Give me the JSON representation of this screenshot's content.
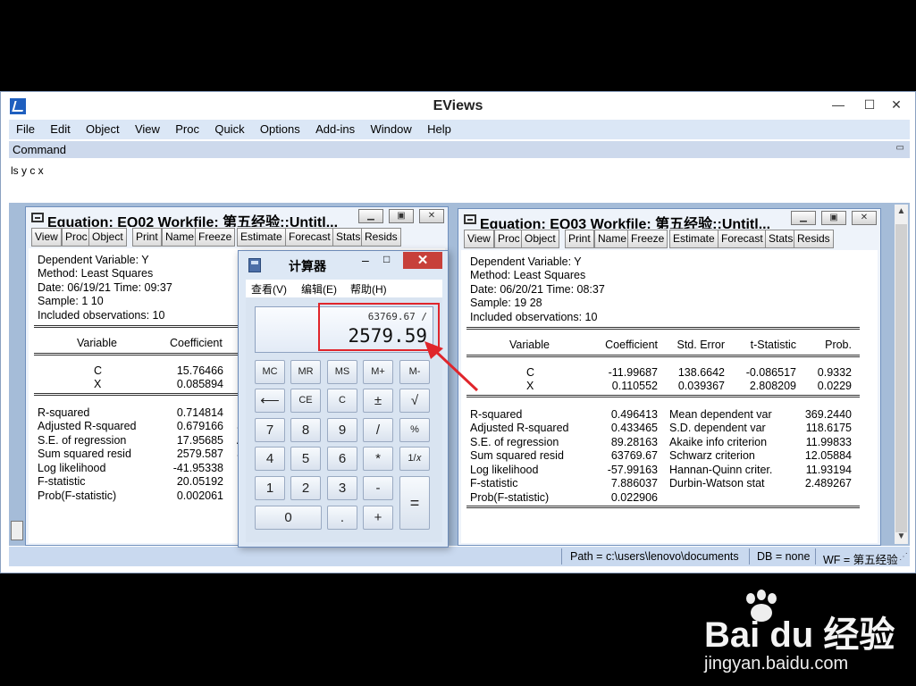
{
  "app": {
    "title": "EViews",
    "min": "—",
    "max": "☐",
    "close": "✕",
    "menu": [
      "File",
      "Edit",
      "Object",
      "View",
      "Proc",
      "Quick",
      "Options",
      "Add-ins",
      "Window",
      "Help"
    ],
    "command_header": "Command",
    "command_text": "ls y c x"
  },
  "toolbar_buttons": [
    "View",
    "Proc",
    "Object",
    "Print",
    "Name",
    "Freeze",
    "Estimate",
    "Forecast",
    "Stats",
    "Resids"
  ],
  "eq1": {
    "title": "Equation: EQ02   Workfile: 第五经验::Untitl...",
    "header": [
      "Dependent Variable: Y",
      "Method: Least Squares",
      "Date: 06/19/21   Time: 09:37",
      "Sample: 1 10",
      "Included observations: 10"
    ],
    "col_variable": "Variable",
    "col_coefficient": "Coefficient",
    "rows": [
      {
        "var": "C",
        "coef": "15.76466"
      },
      {
        "var": "X",
        "coef": "0.085894"
      }
    ],
    "stats": [
      {
        "label": "R-squared",
        "value": "0.714814",
        "extra": "M"
      },
      {
        "label": "Adjusted R-squared",
        "value": "0.679166",
        "extra": "S"
      },
      {
        "label": "S.E. of regression",
        "value": "17.95685",
        "extra": "A"
      },
      {
        "label": "Sum squared resid",
        "value": "2579.587",
        "extra": "S"
      },
      {
        "label": "Log likelihood",
        "value": "-41.95338",
        "extra": "H"
      },
      {
        "label": "F-statistic",
        "value": "20.05192",
        "extra": "D"
      },
      {
        "label": "Prob(F-statistic)",
        "value": "0.002061",
        "extra": ""
      }
    ]
  },
  "eq2": {
    "title": "Equation: EQ03   Workfile: 第五经验::Untitl...",
    "header": [
      "Dependent Variable: Y",
      "Method: Least Squares",
      "Date: 06/20/21   Time: 08:37",
      "Sample: 19 28",
      "Included observations: 10"
    ],
    "columns": [
      "Variable",
      "Coefficient",
      "Std. Error",
      "t-Statistic",
      "Prob."
    ],
    "rows": [
      {
        "var": "C",
        "coef": "-11.99687",
        "se": "138.6642",
        "t": "-0.086517",
        "p": "0.9332"
      },
      {
        "var": "X",
        "coef": "0.110552",
        "se": "0.039367",
        "t": "2.808209",
        "p": "0.0229"
      }
    ],
    "stats_left": [
      {
        "label": "R-squared",
        "value": "0.496413"
      },
      {
        "label": "Adjusted R-squared",
        "value": "0.433465"
      },
      {
        "label": "S.E. of regression",
        "value": "89.28163"
      },
      {
        "label": "Sum squared resid",
        "value": "63769.67"
      },
      {
        "label": "Log likelihood",
        "value": "-57.99163"
      },
      {
        "label": "F-statistic",
        "value": "7.886037"
      },
      {
        "label": "Prob(F-statistic)",
        "value": "0.022906"
      }
    ],
    "stats_right": [
      {
        "label": "Mean dependent var",
        "value": "369.2440"
      },
      {
        "label": "S.D. dependent var",
        "value": "118.6175"
      },
      {
        "label": "Akaike info criterion",
        "value": "11.99833"
      },
      {
        "label": "Schwarz criterion",
        "value": "12.05884"
      },
      {
        "label": "Hannan-Quinn criter.",
        "value": "11.93194"
      },
      {
        "label": "Durbin-Watson stat",
        "value": "2.489267"
      }
    ]
  },
  "calculator": {
    "title": "计算器",
    "close": "✕",
    "menu": [
      "查看(V)",
      "编辑(E)",
      "帮助(H)"
    ],
    "expression": "63769.67 /",
    "display": "2579.59",
    "keys": {
      "mc": "MC",
      "mr": "MR",
      "ms": "MS",
      "mplus": "M+",
      "mminus": "M-",
      "back": "⟵",
      "ce": "CE",
      "c": "C",
      "pm": "±",
      "sqrt": "√",
      "k7": "7",
      "k8": "8",
      "k9": "9",
      "div": "/",
      "pct": "%",
      "k4": "4",
      "k5": "5",
      "k6": "6",
      "mul": "*",
      "recip": "1/𝑥",
      "k1": "1",
      "k2": "2",
      "k3": "3",
      "sub": "-",
      "eq": "=",
      "k0": "0",
      "dot": ".",
      "add": "+"
    }
  },
  "status": {
    "path": "Path = c:\\users\\lenovo\\documents",
    "db": "DB = none",
    "wf": "WF = 第五经验"
  },
  "watermark": {
    "logo": "Bai du 经验",
    "url": "jingyan.baidu.com"
  }
}
